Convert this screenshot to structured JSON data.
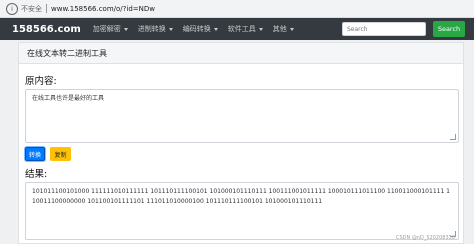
{
  "browser": {
    "security_text": "不安全",
    "url": "www.158566.com/o/?id=NDw"
  },
  "navbar": {
    "brand": "158566.com",
    "menu": [
      "加密解密",
      "进制转换",
      "编码转换",
      "软件工具",
      "其他"
    ],
    "search_placeholder": "Search",
    "search_button": "Search"
  },
  "card": {
    "title": "在线文本转二进制工具",
    "source_label": "原内容:",
    "source_text": "在线工具也许是最好的工具",
    "convert_button": "转换",
    "copy_button": "复制",
    "result_label": "结果:",
    "result_text": "101011100101000 111111010111111 101110111100101 101000101110111 100111001011111 100010111011100 110011000101111 110011100000000 101100101111101 111011010000100 101110111100101 101000101110111"
  },
  "watermark": "CSDN @nD_520208338"
}
